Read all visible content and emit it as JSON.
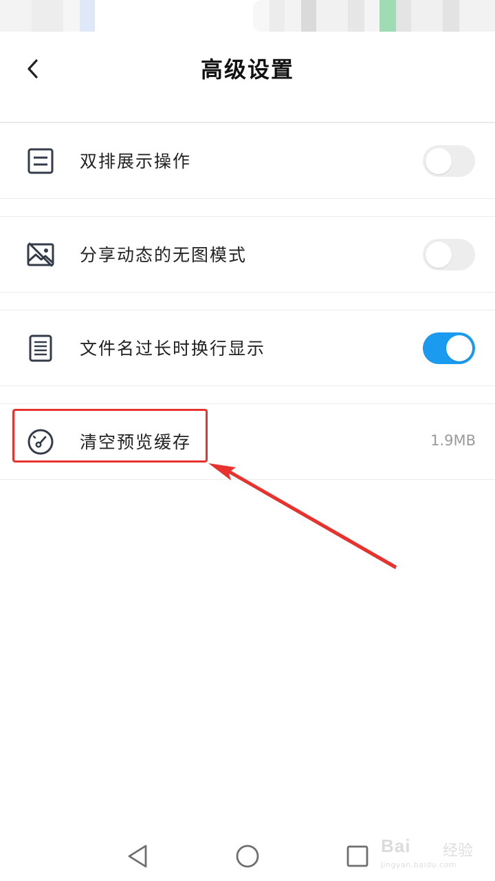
{
  "header": {
    "title": "高级设置",
    "back_icon": "chevron-left-icon"
  },
  "settings": [
    {
      "icon": "document-lines-icon",
      "label": "双排展示操作",
      "toggle_on": false
    },
    {
      "icon": "image-off-icon",
      "label": "分享动态的无图模式",
      "toggle_on": false
    },
    {
      "icon": "document-text-icon",
      "label": "文件名过长时换行显示",
      "toggle_on": true
    },
    {
      "icon": "speedometer-icon",
      "label": "清空预览缓存",
      "value": "1.9MB"
    }
  ],
  "colors": {
    "toggle_on": "#1a9bf0",
    "toggle_off": "#ededed",
    "annotation": "#e8322e"
  },
  "navbar": {
    "buttons": [
      "back-triangle-icon",
      "home-circle-icon",
      "recents-square-icon"
    ]
  },
  "watermark": {
    "main": "Bai",
    "cn": "经验",
    "url": "jingyan.baidu.com"
  }
}
